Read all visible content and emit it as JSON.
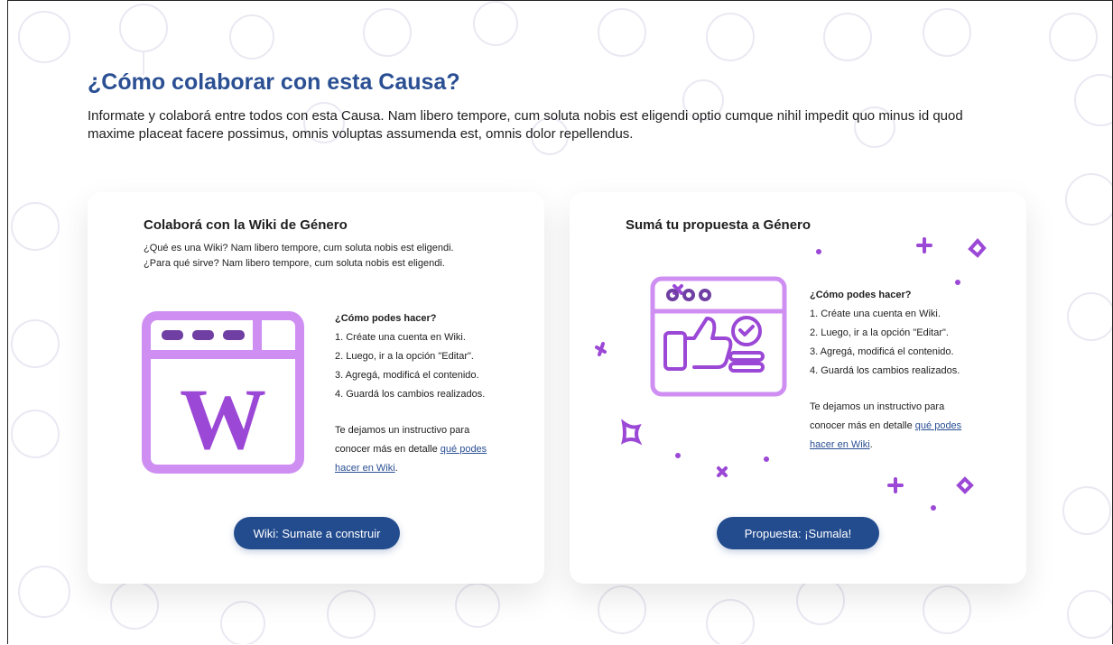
{
  "section": {
    "heading": "¿Cómo colaborar con esta Causa?",
    "intro": "Informate y colaborá entre todos con esta Causa. Nam libero tempore, cum soluta nobis est eligendi optio cumque nihil impedit quo minus id quod maxime placeat facere possimus, omnis voluptas assumenda est, omnis dolor repellendus."
  },
  "wiki_card": {
    "title": "Colaborá con la Wiki de Género",
    "description_lines": [
      "¿Qué es una Wiki? Nam libero tempore, cum soluta nobis est eligendi.",
      "¿Para qué sirve? Nam libero tempore, cum soluta nobis est eligendi."
    ],
    "illustration_icon": "wiki-browser-icon",
    "illustration_letter": "W",
    "how_title": "¿Cómo podes hacer?",
    "steps": [
      "1. Créate una cuenta en Wiki.",
      "2. Luego, ir a la opción \"Editar\".",
      "3. Agregá, modificá el contenido.",
      "4. Guardá los cambios realizados."
    ],
    "instr_lines": [
      "Te dejamos un instructivo para",
      "conocer más en detalle "
    ],
    "link_lines": [
      "qué podes",
      "hacer en Wiki"
    ],
    "link_suffix": ".",
    "button_label": "Wiki: Sumate a construir"
  },
  "proposal_card": {
    "title": "Sumá tu propuesta a Género",
    "illustration_icon": "thumbs-up-browser-icon",
    "how_title": "¿Cómo podes hacer?",
    "steps": [
      "1. Créate una cuenta en Wiki.",
      "2. Luego, ir a la opción \"Editar\".",
      "3. Agregá, modificá el contenido.",
      "4. Guardá los cambios realizados."
    ],
    "instr_lines": [
      "Te dejamos un instructivo para",
      "conocer más en detalle "
    ],
    "link_lines": [
      "qué podes",
      "hacer en Wiki"
    ],
    "link_suffix": ".",
    "button_label": "Propuesta: ¡Sumala!"
  },
  "colors": {
    "heading": "#2a4f93",
    "button": "#234c8f",
    "illustration_light": "#cf8ff2",
    "illustration_dark": "#9b48d6",
    "pattern": "#ece9f3"
  }
}
